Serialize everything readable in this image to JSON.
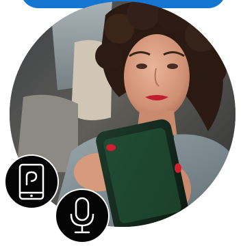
{
  "colors": {
    "accent": "#1476d0",
    "badge_background": "#050505",
    "icon_stroke": "#ffffff"
  },
  "icons": {
    "phone_app": "smartphone-icon",
    "microphone": "microphone-icon"
  },
  "photo": {
    "subject": "woman-using-smartphone-photo"
  }
}
